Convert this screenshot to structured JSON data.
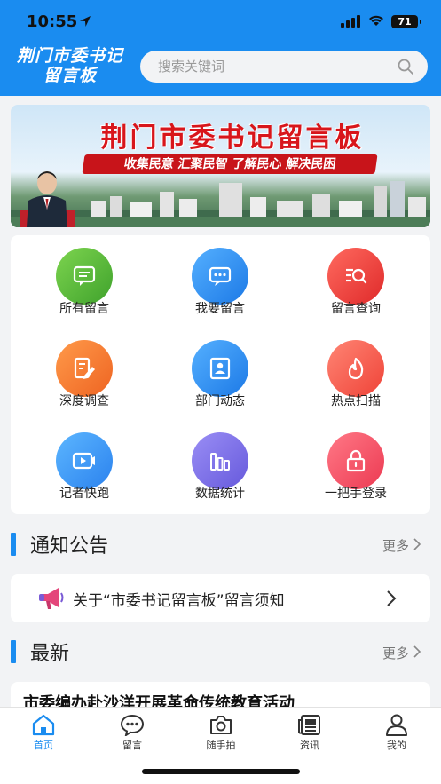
{
  "status_bar": {
    "time": "10:55",
    "battery": "71"
  },
  "header": {
    "logo_line1": "荆门市委书记",
    "logo_line2": "留言板",
    "search_placeholder": "搜索关键词"
  },
  "banner": {
    "title": "荆门市委书记留言板",
    "slogan": "收集民意  汇聚民智  了解民心  解决民困"
  },
  "menu": [
    {
      "label": "所有留言",
      "icon": "message-list-icon",
      "color": "#58b83c"
    },
    {
      "label": "我要留言",
      "icon": "chat-bubble-icon",
      "color": "#2b8ff0"
    },
    {
      "label": "留言查询",
      "icon": "search-list-icon",
      "color": "#ec3e35"
    },
    {
      "label": "深度调查",
      "icon": "edit-pen-icon",
      "color": "#f27a32"
    },
    {
      "label": "部门动态",
      "icon": "department-card-icon",
      "color": "#2b8ff0"
    },
    {
      "label": "热点扫描",
      "icon": "flame-icon",
      "color": "#f0534a"
    },
    {
      "label": "记者快跑",
      "icon": "video-icon",
      "color": "#3a8ff0"
    },
    {
      "label": "数据统计",
      "icon": "bar-chart-icon",
      "color": "#7a70e6"
    },
    {
      "label": "一把手登录",
      "icon": "lock-icon",
      "color": "#f0475c"
    }
  ],
  "notice_section": {
    "title": "通知公告",
    "more": "更多"
  },
  "notice_item": {
    "text": "关于“市委书记留言板”留言须知"
  },
  "latest_section": {
    "title": "最新",
    "more": "更多"
  },
  "latest_item": {
    "title": "市委编办赴沙洋开展革命传统教育活动"
  },
  "tabs": [
    {
      "label": "首页",
      "icon": "home-icon",
      "active": true
    },
    {
      "label": "留言",
      "icon": "comment-icon",
      "active": false
    },
    {
      "label": "随手拍",
      "icon": "camera-icon",
      "active": false
    },
    {
      "label": "资讯",
      "icon": "news-icon",
      "active": false
    },
    {
      "label": "我的",
      "icon": "user-icon",
      "active": false
    }
  ],
  "colors": {
    "primary": "#1a8cf0",
    "banner_red": "#d8161b"
  }
}
